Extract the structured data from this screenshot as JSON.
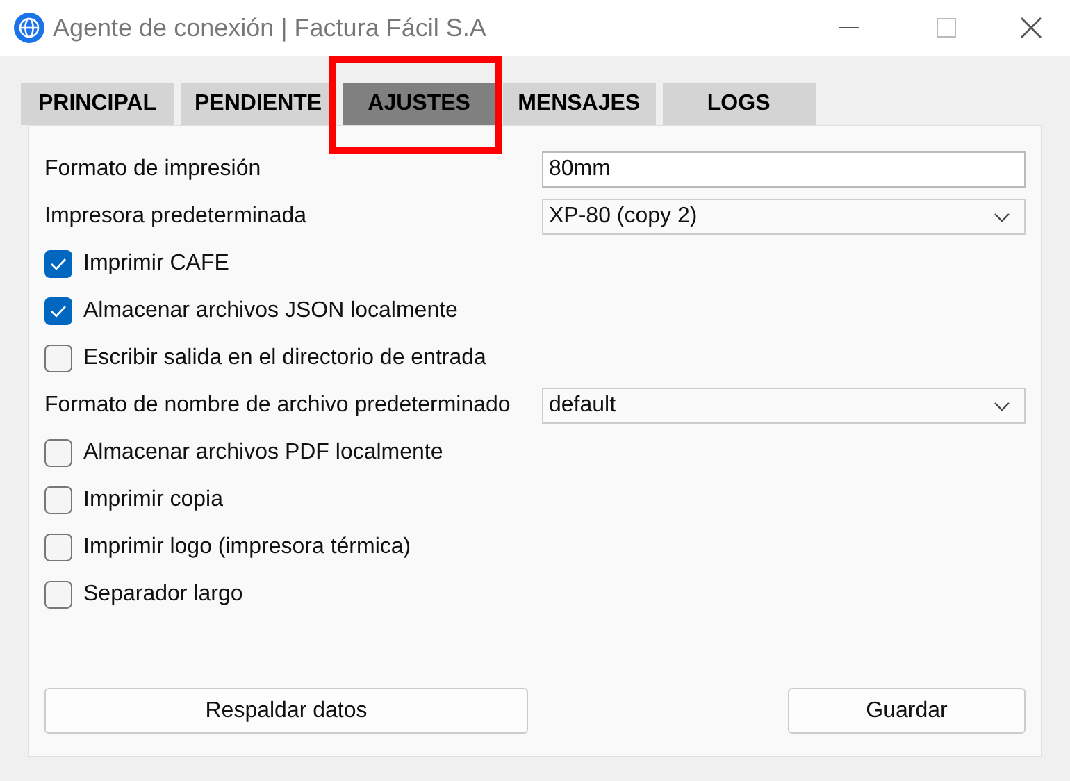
{
  "window": {
    "title": "Agente de conexión | Factura Fácil S.A"
  },
  "tabs": [
    {
      "label": "PRINCIPAL",
      "selected": false
    },
    {
      "label": "PENDIENTE",
      "selected": false
    },
    {
      "label": "AJUSTES",
      "selected": true,
      "highlighted": true
    },
    {
      "label": "MENSAJES",
      "selected": false
    },
    {
      "label": "LOGS",
      "selected": false
    }
  ],
  "settings": [
    {
      "kind": "field",
      "label": "Formato de impresión",
      "value": "80mm"
    },
    {
      "kind": "select",
      "label": "Impresora predeterminada",
      "value": "XP-80 (copy 2)"
    },
    {
      "kind": "checkbox",
      "label": "Imprimir CAFE",
      "checked": true
    },
    {
      "kind": "checkbox",
      "label": "Almacenar archivos JSON localmente",
      "checked": true
    },
    {
      "kind": "checkbox",
      "label": "Escribir salida en el directorio de entrada",
      "checked": false
    },
    {
      "kind": "select",
      "label": "Formato de nombre de archivo predeterminado",
      "value": "default"
    },
    {
      "kind": "checkbox",
      "label": "Almacenar archivos PDF localmente",
      "checked": false
    },
    {
      "kind": "checkbox",
      "label": "Imprimir copia",
      "checked": false
    },
    {
      "kind": "checkbox",
      "label": "Imprimir logo (impresora térmica)",
      "checked": false
    },
    {
      "kind": "checkbox",
      "label": "Separador largo",
      "checked": false
    }
  ],
  "buttons": [
    "Respaldar datos",
    "Guardar"
  ]
}
